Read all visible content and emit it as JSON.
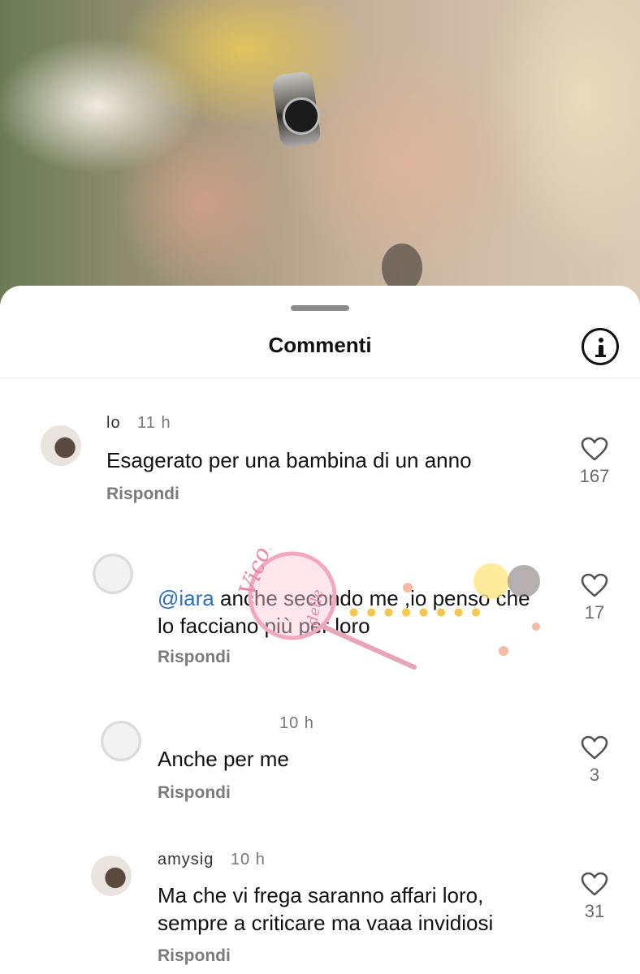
{
  "sheet": {
    "title": "Commenti",
    "info_icon": "info-icon",
    "handle_icon": "drag-handle"
  },
  "comments": [
    {
      "user": "lo",
      "time": "11 h",
      "text": "Esagerato per una bambina di un anno",
      "mention": "",
      "reply_label": "Rispondi",
      "likes": "167"
    },
    {
      "user": "",
      "time": "",
      "mention": "@",
      "mention_rest": "iara",
      "text": " anche secondo me ,io penso che lo facciano più per loro",
      "reply_label": "Rispondi",
      "likes": "17"
    },
    {
      "user": "",
      "time": "10 h",
      "text": "Anche per me",
      "mention": "",
      "reply_label": "Rispondi",
      "likes": "3"
    },
    {
      "user": "amysig",
      "time": "10 h",
      "text": "Ma che vi frega saranno affari loro, sempre a criticare ma vaaa invidiosi",
      "mention": "",
      "reply_label": "Rispondi",
      "likes": "31"
    }
  ],
  "watermark": {
    "brand": "Vicolo delle News"
  },
  "colors": {
    "mention": "#2f6fb5",
    "reply": "#7b7b7b",
    "like_count": "#6b6b6b"
  }
}
